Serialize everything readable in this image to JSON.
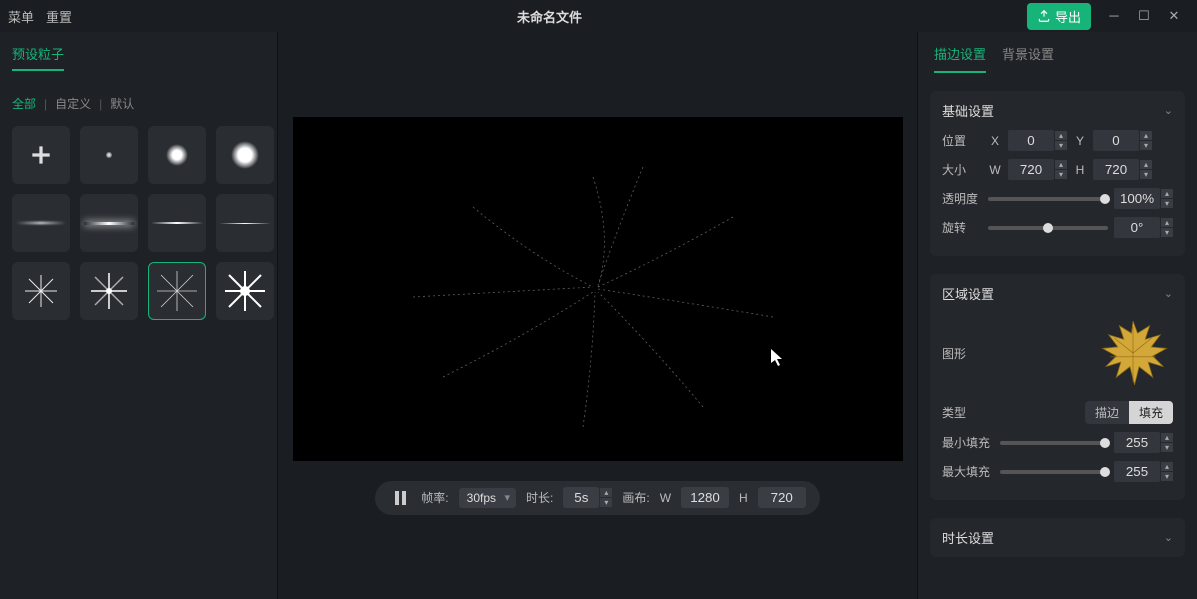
{
  "titlebar": {
    "menu": "菜单",
    "reset": "重置",
    "filename": "未命名文件",
    "export": "导出"
  },
  "leftPanel": {
    "tab_preset": "预设粒子",
    "filters": {
      "all": "全部",
      "custom": "自定义",
      "default": "默认"
    }
  },
  "bottomBar": {
    "fps_label": "帧率:",
    "fps_value": "30fps",
    "duration_label": "时长:",
    "duration_value": "5s",
    "canvas_label": "画布:",
    "w_label": "W",
    "w_value": "1280",
    "h_label": "H",
    "h_value": "720"
  },
  "rightTabs": {
    "stroke": "描边设置",
    "background": "背景设置"
  },
  "basicSection": {
    "title": "基础设置",
    "position": "位置",
    "x_label": "X",
    "x_value": "0",
    "y_label": "Y",
    "y_value": "0",
    "size": "大小",
    "w_label": "W",
    "w_value": "720",
    "h_label": "H",
    "h_value": "720",
    "opacity": "透明度",
    "opacity_value": "100%",
    "rotation": "旋转",
    "rotation_value": "0°"
  },
  "areaSection": {
    "title": "区域设置",
    "shape": "图形",
    "type": "类型",
    "type_stroke": "描边",
    "type_fill": "填充",
    "min_fill": "最小填充",
    "min_fill_value": "255",
    "max_fill": "最大填充",
    "max_fill_value": "255"
  },
  "durationSection": {
    "title": "时长设置"
  }
}
